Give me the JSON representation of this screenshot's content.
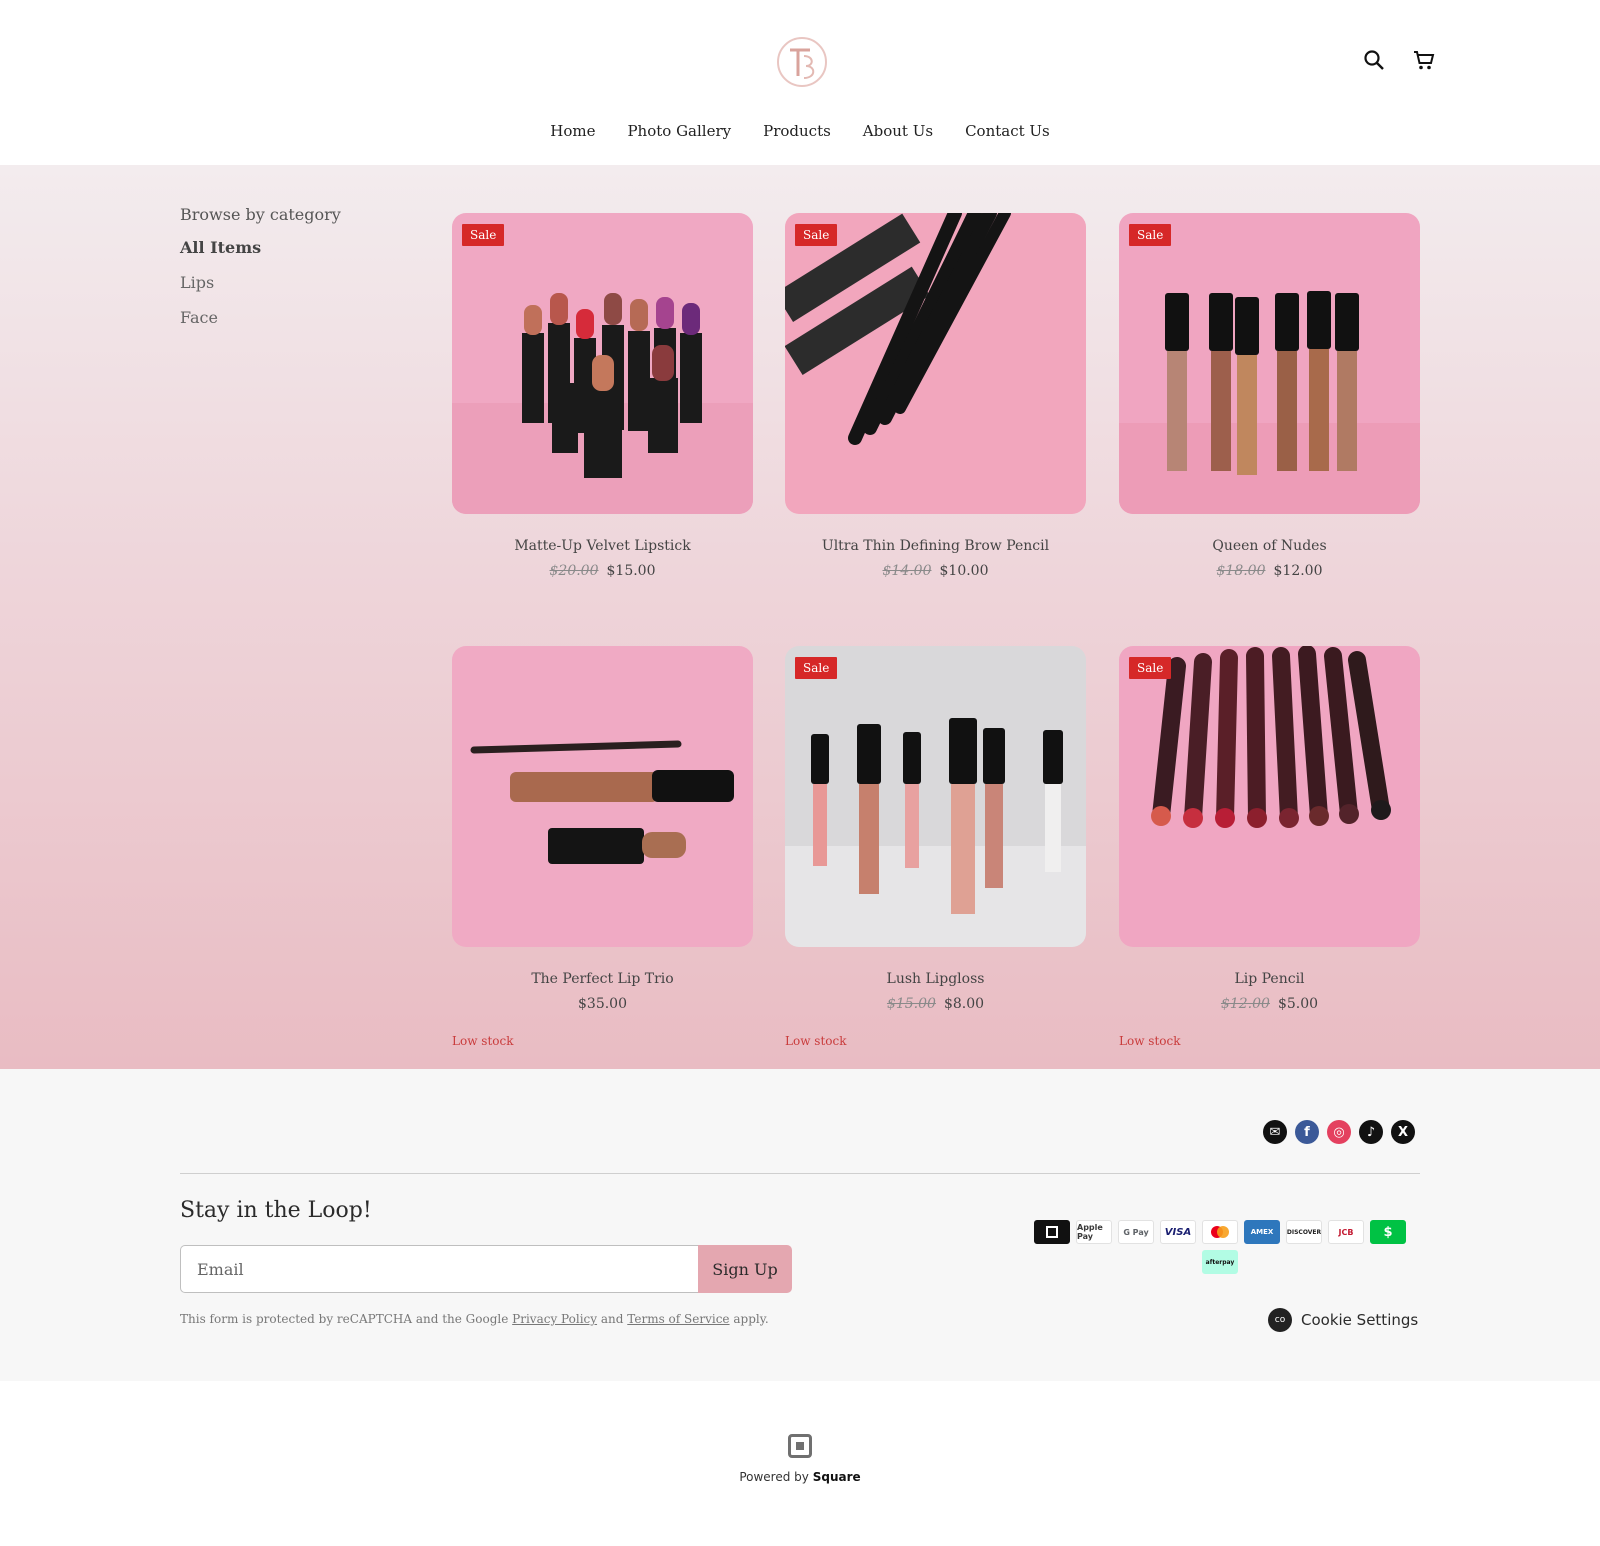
{
  "header": {
    "nav": [
      "Home",
      "Photo Gallery",
      "Products",
      "About Us",
      "Contact Us"
    ],
    "icons": [
      "search-icon",
      "cart-icon"
    ]
  },
  "sidebar": {
    "heading": "Browse by category",
    "categories": [
      "All Items",
      "Lips",
      "Face"
    ],
    "active": "All Items"
  },
  "badge": "Sale",
  "products": [
    {
      "name": "Matte-Up Velvet Lipstick",
      "old_price": "$20.00",
      "price": "$15.00",
      "sale": true,
      "stock": ""
    },
    {
      "name": "Ultra Thin Defining Brow Pencil",
      "old_price": "$14.00",
      "price": "$10.00",
      "sale": true,
      "stock": ""
    },
    {
      "name": "Queen of Nudes",
      "old_price": "$18.00",
      "price": "$12.00",
      "sale": true,
      "stock": ""
    },
    {
      "name": "The Perfect Lip Trio",
      "old_price": "",
      "price": "$35.00",
      "sale": false,
      "stock": "Low stock"
    },
    {
      "name": "Lush Lipgloss",
      "old_price": "$15.00",
      "price": "$8.00",
      "sale": true,
      "stock": "Low stock"
    },
    {
      "name": "Lip Pencil",
      "old_price": "$12.00",
      "price": "$5.00",
      "sale": true,
      "stock": "Low stock"
    }
  ],
  "footer": {
    "social": [
      "email-icon",
      "facebook-icon",
      "instagram-icon",
      "tiktok-icon",
      "x-icon"
    ],
    "loop_title": "Stay in the Loop!",
    "email_placeholder": "Email",
    "signup_label": "Sign Up",
    "recaptcha_prefix": "This form is protected by reCAPTCHA and the Google",
    "privacy_label": "Privacy Policy",
    "and_label": "and",
    "terms_label": "Terms of Service",
    "recaptcha_suffix": "apply.",
    "payments": [
      "Square",
      "Apple Pay",
      "G Pay",
      "VISA",
      "Mastercard",
      "AMEX",
      "DISCOVER",
      "JCB",
      "Cash App",
      "afterpay"
    ],
    "cookie_label": "Cookie Settings"
  },
  "powered": {
    "prefix": "Powered by",
    "brand": "Square"
  },
  "colors": {
    "sale": "#d62828",
    "signup": "#e4a7b0",
    "low_stock": "#c93b3b"
  }
}
